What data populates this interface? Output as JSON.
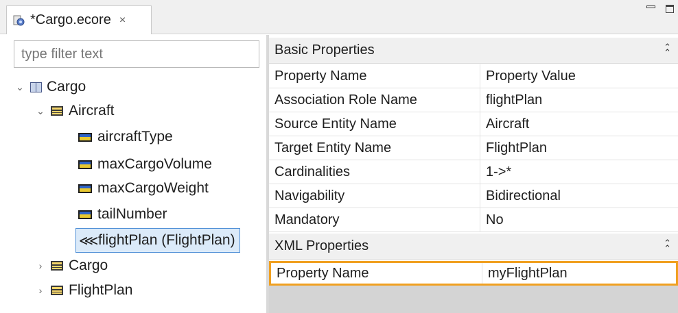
{
  "tab": {
    "label": "*Cargo.ecore",
    "close": "×"
  },
  "filter": {
    "placeholder": "type filter text"
  },
  "tree": {
    "root": "Cargo",
    "aircraft": "Aircraft",
    "attrs": [
      "aircraftType",
      "maxCargoVolume",
      "maxCargoWeight",
      "tailNumber"
    ],
    "reference": "flightPlan (FlightPlan)",
    "cargo_class": "Cargo",
    "flightplan_class": "FlightPlan"
  },
  "basic": {
    "title": "Basic Properties",
    "header": {
      "name": "Property Name",
      "value": "Property Value"
    },
    "rows": [
      {
        "name": "Association Role Name",
        "value": "flightPlan"
      },
      {
        "name": "Source Entity Name",
        "value": "Aircraft"
      },
      {
        "name": "Target Entity Name",
        "value": "FlightPlan"
      },
      {
        "name": "Cardinalities",
        "value": "1->*"
      },
      {
        "name": "Navigability",
        "value": "Bidirectional"
      },
      {
        "name": "Mandatory",
        "value": "No"
      }
    ]
  },
  "xml": {
    "title": "XML Properties",
    "row": {
      "name": "Property Name",
      "value": "myFlightPlan"
    }
  },
  "icons": {
    "collapse": "collapse-icon",
    "twisty": "chevron-icon"
  }
}
